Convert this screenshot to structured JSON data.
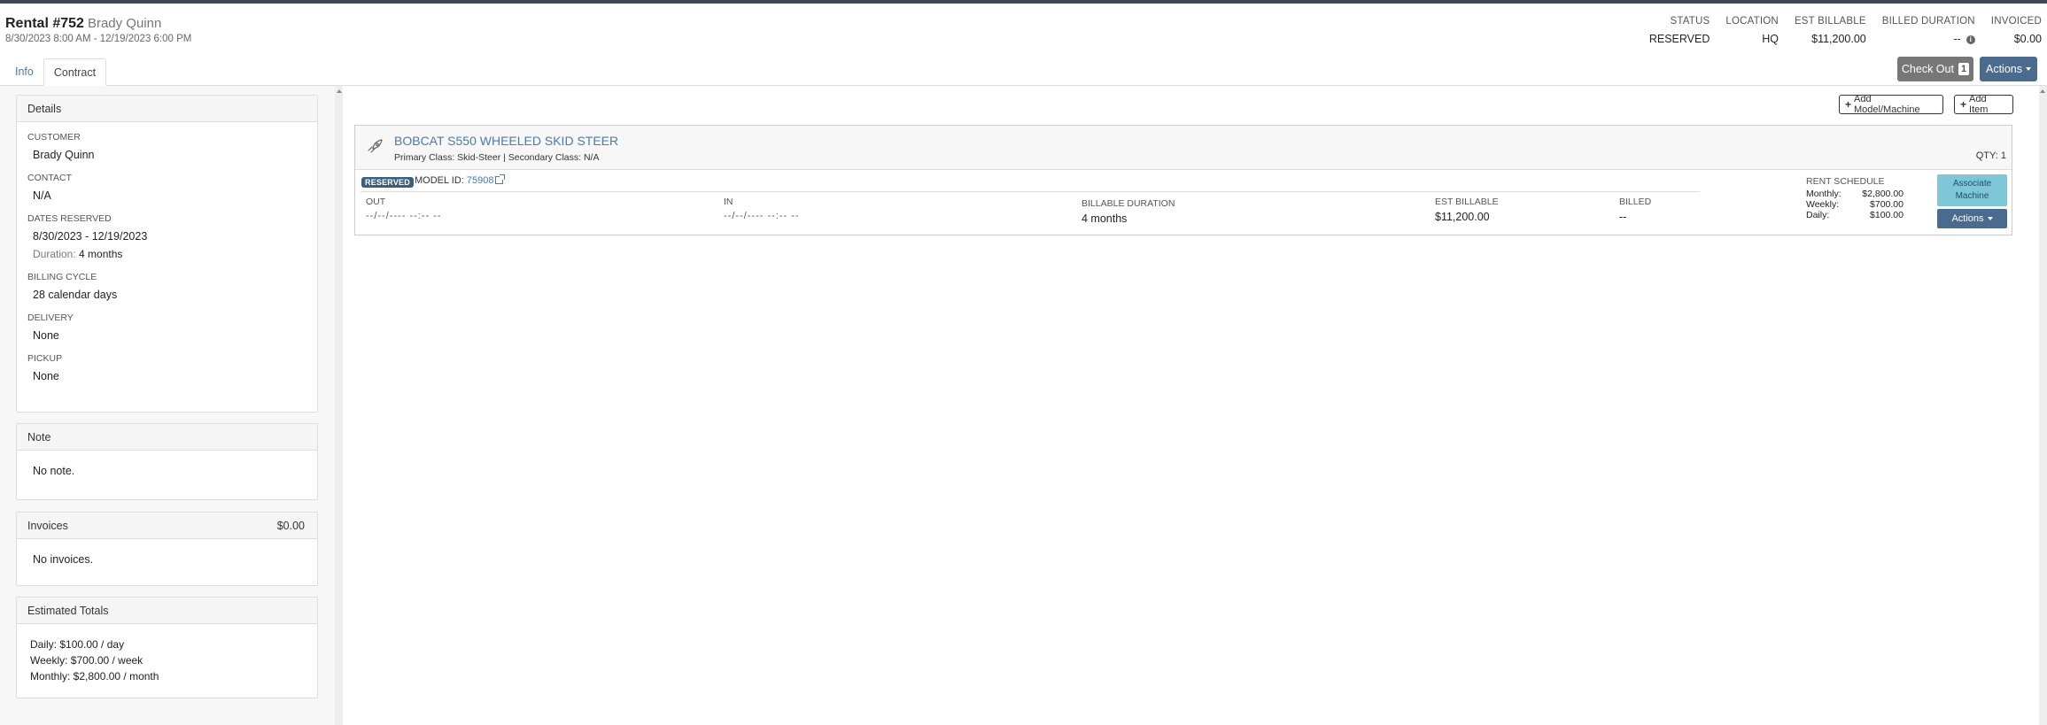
{
  "header": {
    "rental_label": "Rental #752",
    "customer_name": "Brady Quinn",
    "date_range": "8/30/2023 8:00 AM - 12/19/2023 6:00 PM"
  },
  "stats": [
    {
      "label": "STATUS",
      "value": "RESERVED"
    },
    {
      "label": "LOCATION",
      "value": "HQ"
    },
    {
      "label": "EST BILLABLE",
      "value": "$11,200.00"
    },
    {
      "label": "BILLED DURATION",
      "value": "--"
    },
    {
      "label": "INVOICED",
      "value": "$0.00"
    }
  ],
  "buttons": {
    "check_out": "Check Out",
    "check_out_count": "1",
    "actions": "Actions",
    "add_model": "Add Model/Machine",
    "add_item": "Add Item"
  },
  "tabs": [
    {
      "label": "Info"
    },
    {
      "label": "Contract"
    }
  ],
  "details": {
    "title": "Details",
    "customer_label": "CUSTOMER",
    "customer_value": "Brady Quinn",
    "contact_label": "CONTACT",
    "contact_value": "N/A",
    "dates_label": "DATES RESERVED",
    "dates_value": "8/30/2023 - 12/19/2023",
    "duration_label": "Duration:",
    "duration_value": "4 months",
    "billing_label": "BILLING CYCLE",
    "billing_value": "28 calendar days",
    "delivery_label": "DELIVERY",
    "delivery_value": "None",
    "pickup_label": "PICKUP",
    "pickup_value": "None"
  },
  "note": {
    "title": "Note",
    "text": "No note."
  },
  "invoices": {
    "title": "Invoices",
    "amount": "$0.00",
    "text": "No invoices."
  },
  "estimated_totals": {
    "title": "Estimated Totals",
    "daily": "Daily: $100.00 / day",
    "weekly": "Weekly: $700.00 / week",
    "monthly": "Monthly: $2,800.00 / month"
  },
  "item": {
    "title": "BOBCAT S550 WHEELED SKID STEER",
    "classes": "Primary Class: Skid-Steer | Secondary Class: N/A",
    "qty": "QTY: 1",
    "status_badge": "RESERVED",
    "model_id_label": "MODEL ID:",
    "model_id": "75908",
    "out_label": "OUT",
    "out_value": "--/--/---- --:-- --",
    "in_label": "IN",
    "in_value": "--/--/---- --:-- --",
    "billable_duration_label": "BILLABLE DURATION",
    "billable_duration_value": "4 months",
    "est_billable_label": "EST BILLABLE",
    "est_billable_value": "$11,200.00",
    "billed_label": "BILLED",
    "billed_value": "--",
    "rent_schedule_label": "RENT SCHEDULE",
    "rent_schedule": [
      {
        "period": "Monthly:",
        "amount": "$2,800.00"
      },
      {
        "period": "Weekly:",
        "amount": "$700.00"
      },
      {
        "period": "Daily:",
        "amount": "$100.00"
      }
    ],
    "associate_line1": "Associate",
    "associate_line2": "Machine",
    "actions": "Actions"
  },
  "colors": {
    "primary_button": "#4b6b8e",
    "link": "#4b7aa8",
    "associate_button": "#7fc6d6",
    "checkout_button": "#777777"
  }
}
